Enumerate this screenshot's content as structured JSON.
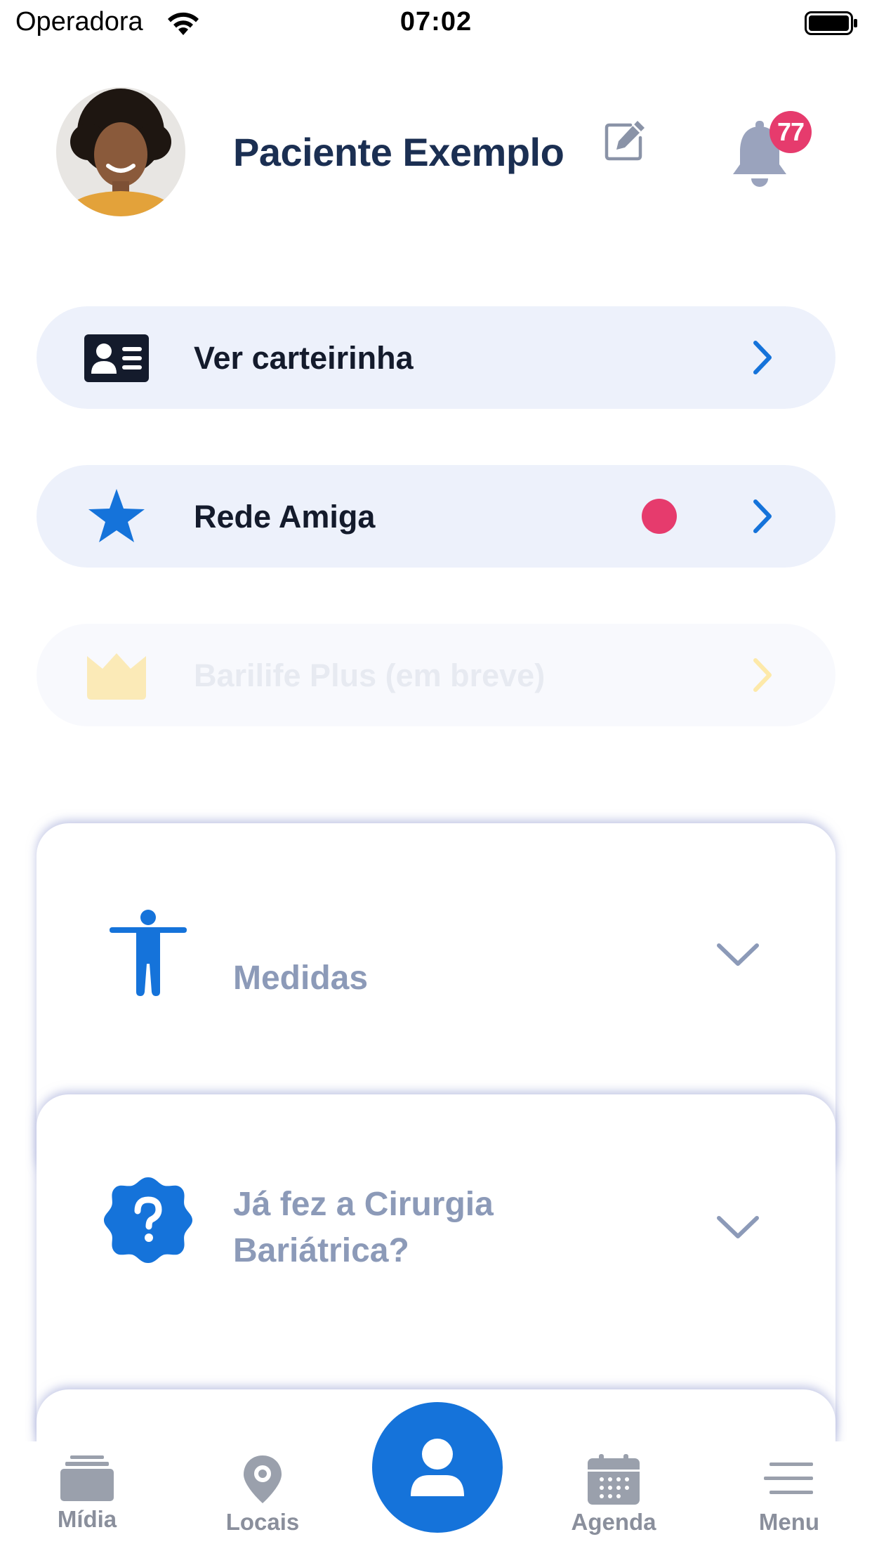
{
  "status_bar": {
    "carrier": "Operadora",
    "time": "07:02"
  },
  "header": {
    "patient_name": "Paciente Exemplo",
    "notification_count": "77"
  },
  "menu": {
    "card_button": {
      "label": "Ver carteirinha"
    },
    "network_button": {
      "label": "Rede Amiga"
    },
    "plus_button": {
      "label": "Barilife Plus (em breve)"
    }
  },
  "sections": {
    "measurements": {
      "label": "Medidas"
    },
    "surgery": {
      "label_line1": "Já fez a Cirurgia",
      "label_line2": "Bariátrica?"
    }
  },
  "bottom_nav": {
    "media": "Mídia",
    "places": "Locais",
    "schedule": "Agenda",
    "menu": "Menu"
  },
  "colors": {
    "accent": "#1573da",
    "badge": "#e63b6d",
    "pill_bg": "#edf1fb",
    "muted_label": "#8c9ab8"
  },
  "icons": {
    "wifi": "wifi-icon",
    "battery": "battery-icon",
    "edit": "edit-icon",
    "bell": "bell-icon",
    "id_card": "id-card-icon",
    "star": "star-icon",
    "crown": "crown-icon",
    "person": "person-icon",
    "question": "question-badge-icon",
    "media": "media-stack-icon",
    "places": "map-pin-icon",
    "profile": "user-icon",
    "schedule": "calendar-icon",
    "menu": "hamburger-icon"
  }
}
